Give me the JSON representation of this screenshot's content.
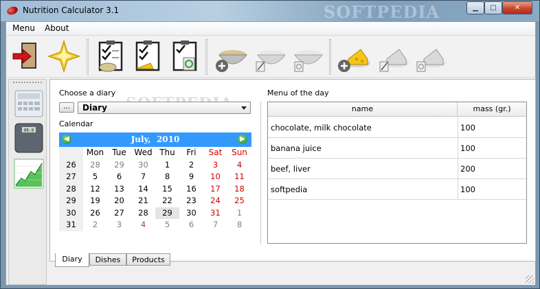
{
  "window": {
    "title": "Nutrition Calculator 3.1",
    "watermark": "SOFTPEDIA"
  },
  "menubar": {
    "items": [
      "Menu",
      "About"
    ]
  },
  "toolbar": {
    "buttons": [
      {
        "name": "exit-button",
        "icon": "exit-door-icon"
      },
      {
        "name": "favorite-button",
        "icon": "star-icon"
      },
      {
        "name": "add-diary-entry-button",
        "icon": "clipboard-dish-icon"
      },
      {
        "name": "edit-diary-entry-button",
        "icon": "clipboard-cheese-icon"
      },
      {
        "name": "delete-diary-entry-button",
        "icon": "clipboard-recycle-icon"
      },
      {
        "name": "add-dish-button",
        "icon": "bowl-add-icon"
      },
      {
        "name": "edit-dish-button",
        "icon": "bowl-edit-icon"
      },
      {
        "name": "delete-dish-button",
        "icon": "bowl-delete-icon"
      },
      {
        "name": "add-product-button",
        "icon": "cheese-add-icon"
      },
      {
        "name": "edit-product-button",
        "icon": "cheese-edit-icon"
      },
      {
        "name": "delete-product-button",
        "icon": "cheese-delete-icon"
      }
    ]
  },
  "sidebar": {
    "buttons": [
      {
        "name": "calculator-button",
        "icon": "calculator-icon"
      },
      {
        "name": "scale-button",
        "icon": "bathroom-scale-icon",
        "display": "88.8"
      },
      {
        "name": "chart-button",
        "icon": "line-chart-icon"
      }
    ]
  },
  "diary": {
    "choose_label": "Choose a diary",
    "browse_label": "...",
    "selected": "Diary",
    "calendar_label": "Calendar"
  },
  "calendar": {
    "month": "July,",
    "year": "2010",
    "weekdays": [
      "Mon",
      "Tue",
      "Wed",
      "Thu",
      "Fri",
      "Sat",
      "Sun"
    ],
    "weeks": [
      {
        "num": "26",
        "days": [
          "28",
          "29",
          "30",
          "1",
          "2",
          "3",
          "4"
        ]
      },
      {
        "num": "27",
        "days": [
          "5",
          "6",
          "7",
          "8",
          "9",
          "10",
          "11"
        ]
      },
      {
        "num": "28",
        "days": [
          "12",
          "13",
          "14",
          "15",
          "16",
          "17",
          "18"
        ]
      },
      {
        "num": "29",
        "days": [
          "19",
          "20",
          "21",
          "22",
          "23",
          "24",
          "25"
        ]
      },
      {
        "num": "30",
        "days": [
          "26",
          "27",
          "28",
          "29",
          "30",
          "31",
          "1"
        ]
      },
      {
        "num": "31",
        "days": [
          "2",
          "3",
          "4",
          "5",
          "6",
          "7",
          "8"
        ]
      }
    ],
    "selected_day": "29"
  },
  "menu_of_day": {
    "label": "Menu of the day",
    "columns": [
      "name",
      "mass (gr.)"
    ],
    "rows": [
      {
        "name": "chocolate, milk chocolate",
        "mass": "100"
      },
      {
        "name": "banana juice",
        "mass": "100"
      },
      {
        "name": "beef, liver",
        "mass": "200"
      },
      {
        "name": "softpedia",
        "mass": "100"
      }
    ]
  },
  "tabs": [
    "Diary",
    "Dishes",
    "Products"
  ],
  "colors": {
    "calendar_header": "#3399ff",
    "weekend": "#d40000",
    "muted": "#808080"
  }
}
